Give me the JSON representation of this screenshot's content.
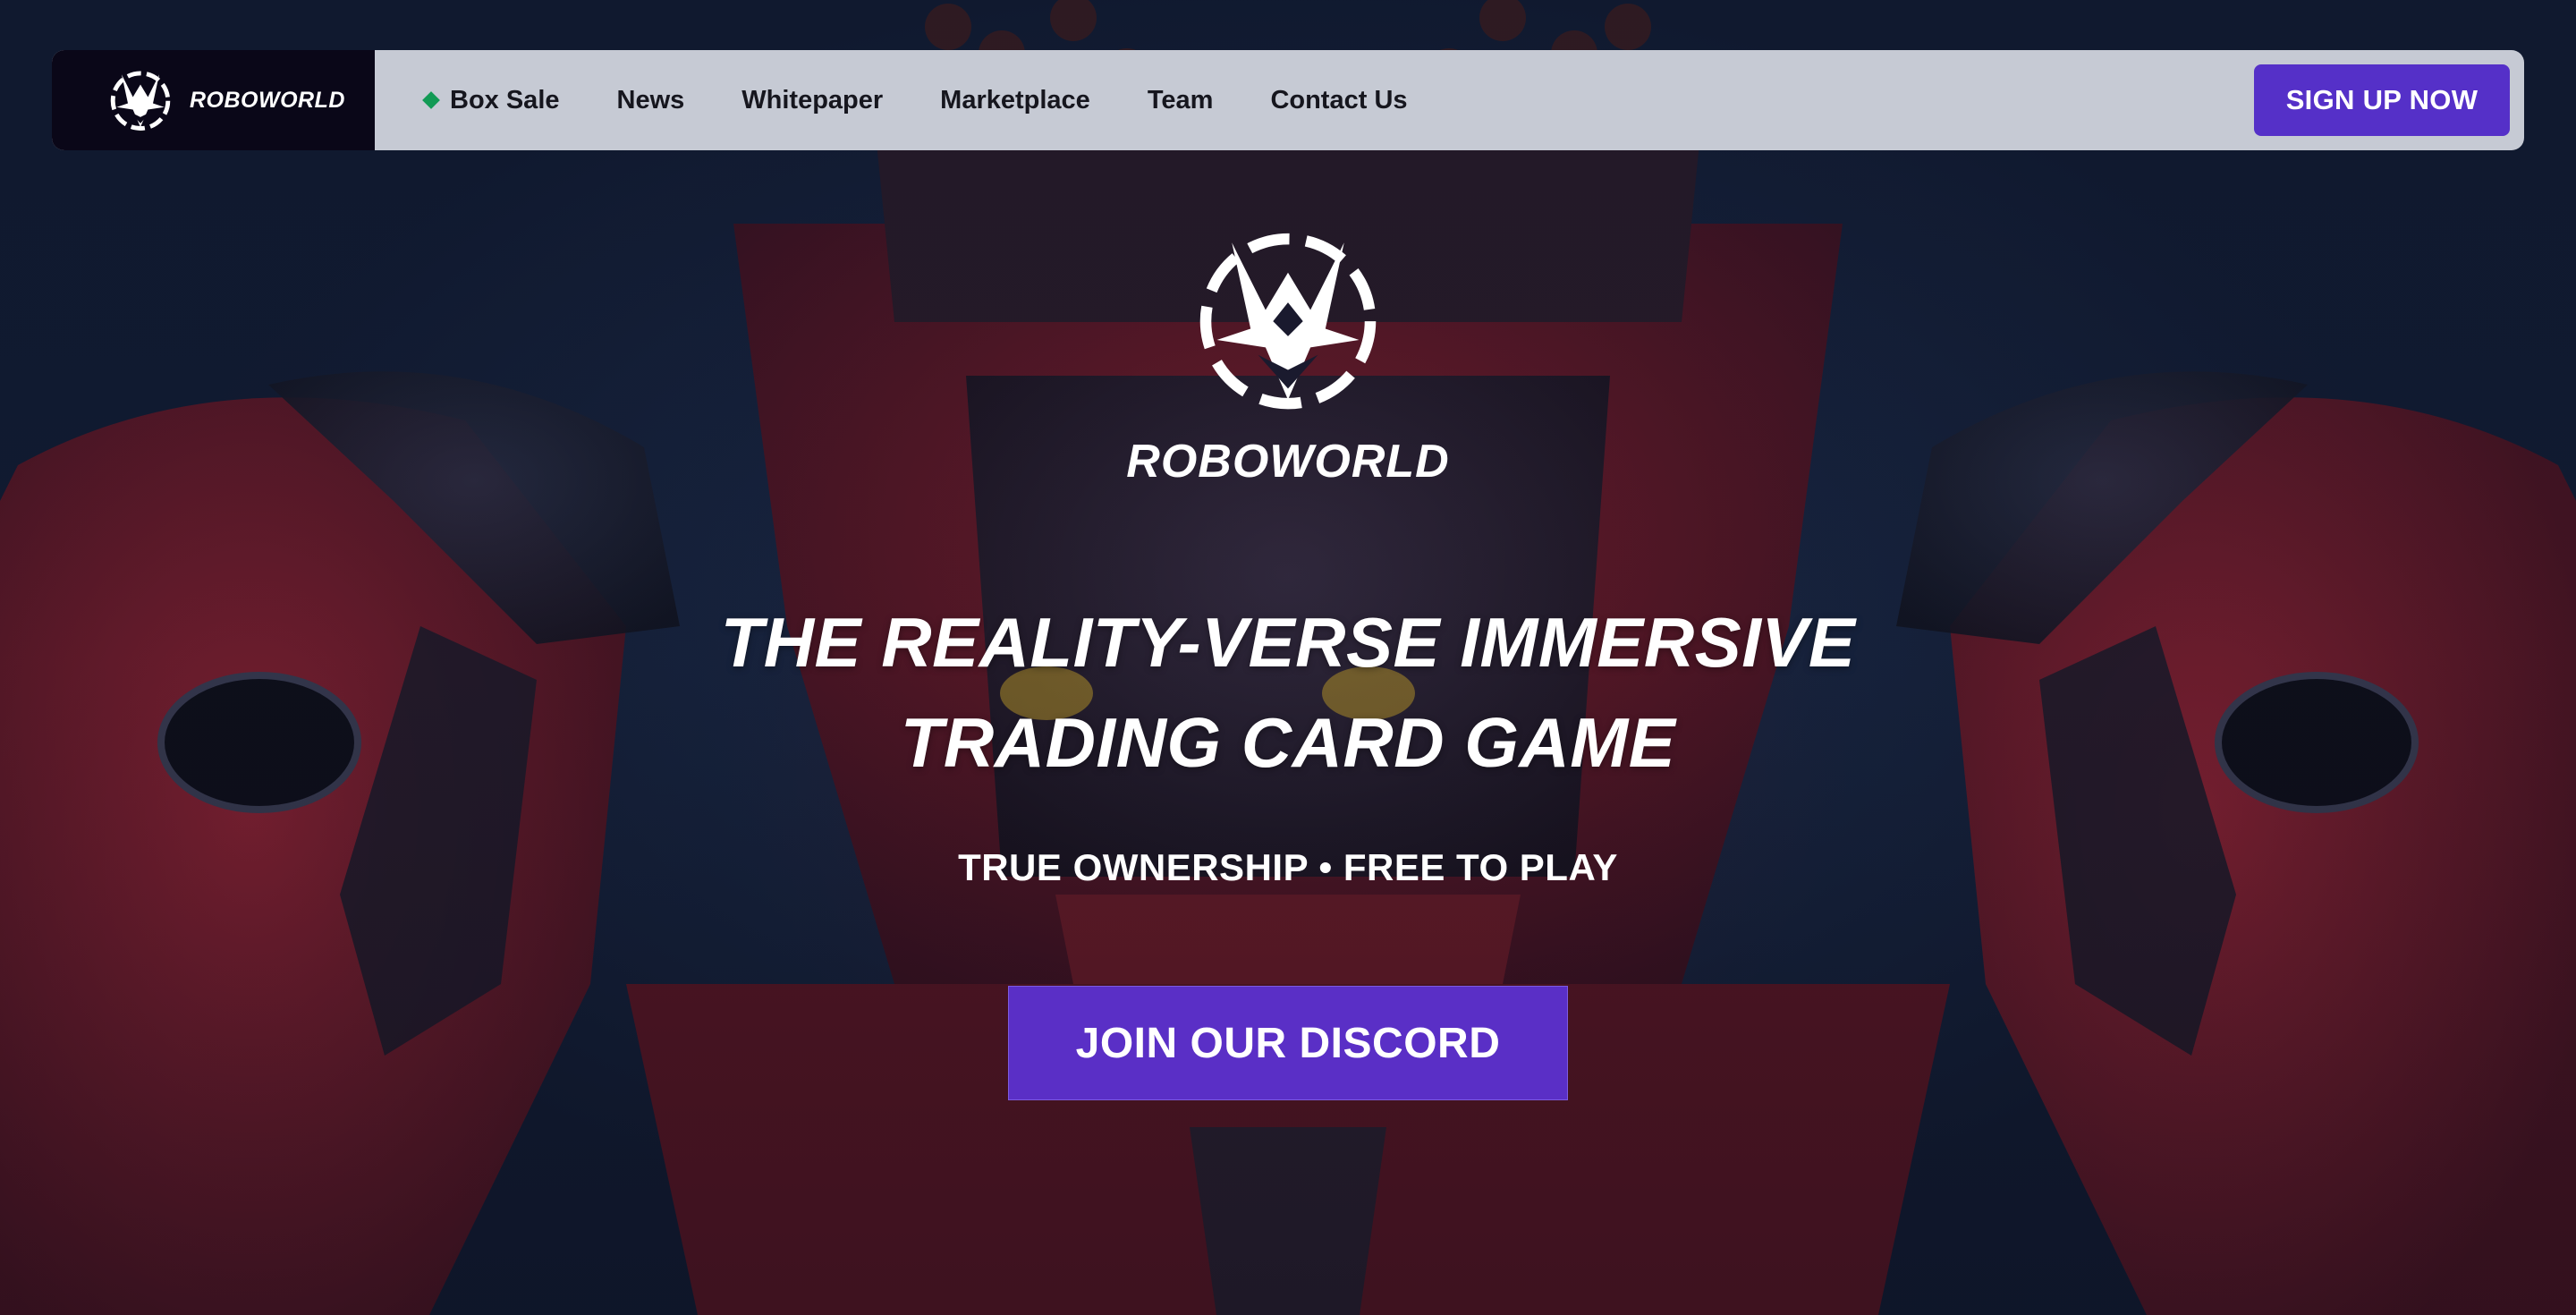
{
  "brand": {
    "name": "ROBOWORLD",
    "logo_icon": "roboworld-mask-icon"
  },
  "nav": {
    "items": [
      {
        "label": "Box Sale",
        "marker_color": "#129a55"
      },
      {
        "label": "News"
      },
      {
        "label": "Whitepaper"
      },
      {
        "label": "Marketplace"
      },
      {
        "label": "Team"
      },
      {
        "label": "Contact Us"
      }
    ],
    "signup_label": "SIGN UP NOW"
  },
  "hero": {
    "brand_name": "ROBOWORLD",
    "headline_line1": "THE REALITY-VERSE IMMERSIVE",
    "headline_line2": "TRADING CARD GAME",
    "tagline": "TRUE OWNERSHIP • FREE TO PLAY",
    "cta_label": "JOIN OUR DISCORD"
  },
  "colors": {
    "accent": "#5530c8",
    "nav_bg": "#c6cad4",
    "brand_bg": "#0a0718",
    "marker": "#129a55"
  }
}
